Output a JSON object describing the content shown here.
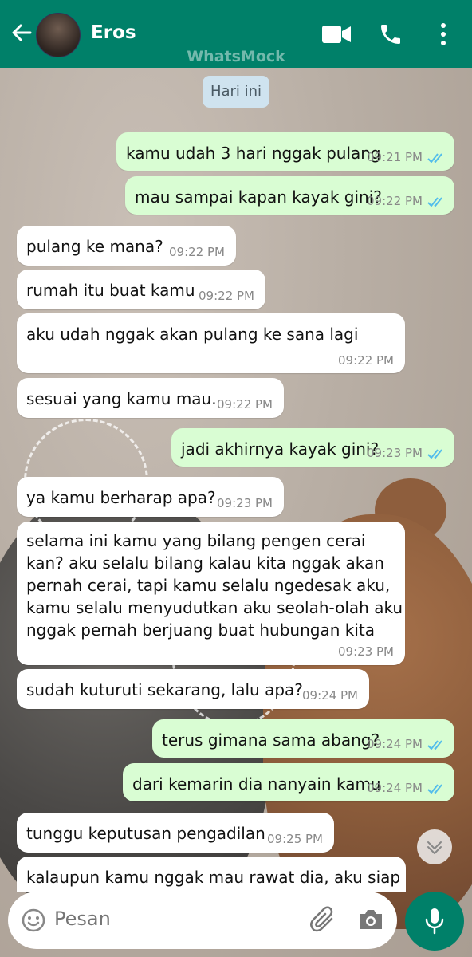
{
  "header": {
    "contact_name": "Eros",
    "watermark": "WhatsMock",
    "icons": [
      "back-arrow-icon",
      "video-call-icon",
      "phone-icon",
      "more-options-icon"
    ]
  },
  "date_badge": "Hari ini",
  "messages": [
    {
      "dir": "out",
      "text": "kamu udah 3 hari nggak pulang",
      "time": "09:21 PM",
      "read": true
    },
    {
      "dir": "out",
      "text": "mau sampai kapan kayak gini?",
      "time": "09:22 PM",
      "read": true
    },
    {
      "dir": "in",
      "text": "pulang ke mana?",
      "time": "09:22 PM"
    },
    {
      "dir": "in",
      "text": "rumah itu buat kamu",
      "time": "09:22 PM"
    },
    {
      "dir": "in",
      "text": "aku udah nggak akan pulang ke sana lagi",
      "time": "09:22 PM"
    },
    {
      "dir": "in",
      "text": "sesuai yang kamu mau.",
      "time": "09:22 PM"
    },
    {
      "dir": "out",
      "text": "jadi akhirnya kayak gini?",
      "time": "09:23 PM",
      "read": true
    },
    {
      "dir": "in",
      "text": "ya kamu berharap apa?",
      "time": "09:23 PM"
    },
    {
      "dir": "in",
      "lines": [
        "selama ini kamu yang bilang pengen cerai",
        "kan? aku selalu bilang kalau kita nggak akan",
        "pernah cerai, tapi kamu selalu ngedesak aku,",
        "kamu selalu menyudutkan aku seolah-olah aku",
        "nggak pernah berjuang buat hubungan kita"
      ],
      "time": "09:23 PM"
    },
    {
      "dir": "in",
      "text": "sudah kuturuti sekarang, lalu apa?",
      "time": "09:24 PM"
    },
    {
      "dir": "out",
      "text": "terus gimana sama abang?",
      "time": "09:24 PM",
      "read": true
    },
    {
      "dir": "out",
      "text": "dari kemarin dia nanyain kamu",
      "time": "09:24 PM",
      "read": true
    },
    {
      "dir": "in",
      "text": "tunggu keputusan pengadilan",
      "time": "09:25 PM"
    },
    {
      "dir": "in",
      "text": "kalaupun kamu nggak mau rawat dia, aku siap"
    }
  ],
  "composer": {
    "placeholder": "Pesan",
    "icons": [
      "emoji-icon",
      "attach-icon",
      "camera-icon",
      "mic-icon",
      "scroll-down-icon"
    ]
  },
  "colors": {
    "header": "#008069",
    "outgoing_bubble": "#d9fdd3",
    "incoming_bubble": "#ffffff",
    "read_ticks": "#53bdeb"
  }
}
